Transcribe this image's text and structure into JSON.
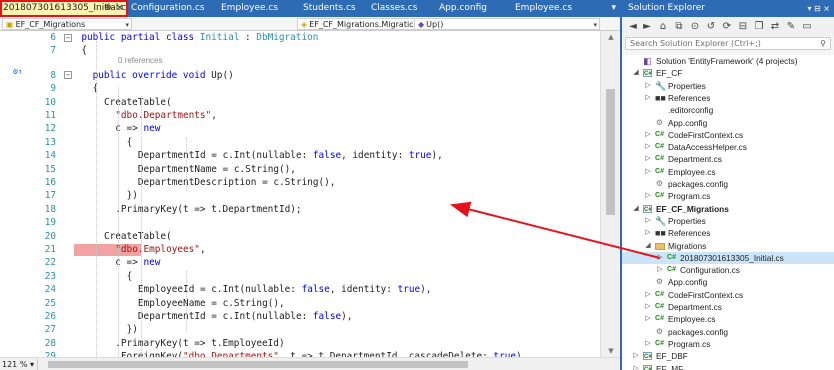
{
  "editor": {
    "tabs": [
      {
        "label": "201807301613305_Initial.cs",
        "active": true
      },
      {
        "label": "Configuration.cs",
        "active": false
      },
      {
        "label": "Employee.cs",
        "active": false
      },
      {
        "label": "Students.cs",
        "active": false
      },
      {
        "label": "Classes.cs",
        "active": false
      },
      {
        "label": "App.config",
        "active": false
      },
      {
        "label": "Employee.cs",
        "active": false
      }
    ],
    "pin_glyph": "⊕",
    "close_glyph": "×",
    "overflow_glyph": "▾",
    "nav": {
      "project": "EF_CF_Migrations",
      "class": "EF_CF_Migrations.Migratic",
      "member": "Up()"
    },
    "codelens": "0 references",
    "zoom": "121 %",
    "lines": [
      {
        "num": "6",
        "indent": 2,
        "tokens": [
          {
            "t": "public partial class ",
            "c": "kw"
          },
          {
            "t": "Initial",
            "c": "cls"
          },
          {
            "t": " : ",
            "c": ""
          },
          {
            "t": "DbMigration",
            "c": "cls"
          }
        ]
      },
      {
        "num": "7",
        "indent": 2,
        "tokens": [
          {
            "t": "{",
            "c": ""
          }
        ]
      },
      {
        "num": "8",
        "indent": 4,
        "tokens": [
          {
            "t": "public override void ",
            "c": "kw"
          },
          {
            "t": "Up()",
            "c": ""
          }
        ]
      },
      {
        "num": "9",
        "indent": 4,
        "tokens": [
          {
            "t": "{",
            "c": ""
          }
        ]
      },
      {
        "num": "10",
        "indent": 6,
        "tokens": [
          {
            "t": "CreateTable(",
            "c": ""
          }
        ]
      },
      {
        "num": "11",
        "indent": 8,
        "tokens": [
          {
            "t": "\"dbo.Departments\"",
            "c": "str"
          },
          {
            "t": ",",
            "c": ""
          }
        ]
      },
      {
        "num": "12",
        "indent": 8,
        "tokens": [
          {
            "t": "c => ",
            "c": ""
          },
          {
            "t": "new",
            "c": "kw"
          }
        ]
      },
      {
        "num": "13",
        "indent": 10,
        "tokens": [
          {
            "t": "{",
            "c": ""
          }
        ]
      },
      {
        "num": "14",
        "indent": 12,
        "tokens": [
          {
            "t": "DepartmentId = c.Int(nullable: ",
            "c": ""
          },
          {
            "t": "false",
            "c": "kw"
          },
          {
            "t": ", identity: ",
            "c": ""
          },
          {
            "t": "true",
            "c": "kw"
          },
          {
            "t": "),",
            "c": ""
          }
        ]
      },
      {
        "num": "15",
        "indent": 12,
        "tokens": [
          {
            "t": "DepartmentName = c.String(),",
            "c": ""
          }
        ]
      },
      {
        "num": "16",
        "indent": 12,
        "tokens": [
          {
            "t": "DepartmentDescription = c.String(),",
            "c": ""
          }
        ]
      },
      {
        "num": "17",
        "indent": 10,
        "tokens": [
          {
            "t": "})",
            "c": ""
          }
        ]
      },
      {
        "num": "18",
        "indent": 8,
        "tokens": [
          {
            "t": ".PrimaryKey(t => t.DepartmentId);",
            "c": ""
          }
        ]
      },
      {
        "num": "19",
        "indent": 0,
        "tokens": []
      },
      {
        "num": "20",
        "indent": 6,
        "tokens": [
          {
            "t": "CreateTable(",
            "c": ""
          }
        ]
      },
      {
        "num": "21",
        "indent": 8,
        "tokens": [
          {
            "t": "\"dbo.Employees\"",
            "c": "str"
          },
          {
            "t": ",",
            "c": ""
          }
        ]
      },
      {
        "num": "22",
        "indent": 8,
        "tokens": [
          {
            "t": "c => ",
            "c": ""
          },
          {
            "t": "new",
            "c": "kw"
          }
        ]
      },
      {
        "num": "23",
        "indent": 10,
        "tokens": [
          {
            "t": "{",
            "c": ""
          }
        ]
      },
      {
        "num": "24",
        "indent": 12,
        "tokens": [
          {
            "t": "EmployeeId = c.Int(nullable: ",
            "c": ""
          },
          {
            "t": "false",
            "c": "kw"
          },
          {
            "t": ", identity: ",
            "c": ""
          },
          {
            "t": "true",
            "c": "kw"
          },
          {
            "t": "),",
            "c": ""
          }
        ]
      },
      {
        "num": "25",
        "indent": 12,
        "tokens": [
          {
            "t": "EmployeeName = c.String(),",
            "c": ""
          }
        ]
      },
      {
        "num": "26",
        "indent": 12,
        "tokens": [
          {
            "t": "DepartmentId = c.Int(nullable: ",
            "c": ""
          },
          {
            "t": "false",
            "c": "kw"
          },
          {
            "t": "),",
            "c": ""
          }
        ]
      },
      {
        "num": "27",
        "indent": 10,
        "tokens": [
          {
            "t": "})",
            "c": ""
          }
        ]
      },
      {
        "num": "28",
        "indent": 8,
        "tokens": [
          {
            "t": ".PrimaryKey(t => t.EmployeeId)",
            "c": ""
          }
        ]
      },
      {
        "num": "29",
        "indent": 8,
        "tokens": [
          {
            "t": ".ForeignKey(",
            "c": ""
          },
          {
            "t": "\"dbo.Departments\"",
            "c": "str"
          },
          {
            "t": ", t => t.DepartmentId, cascadeDelete: ",
            "c": ""
          },
          {
            "t": "true",
            "c": "kw"
          },
          {
            "t": ")",
            "c": ""
          }
        ]
      }
    ]
  },
  "solution_explorer": {
    "title": "Solution Explorer",
    "title_icons": "▾ ⊟ ×",
    "search_placeholder": "Search Solution Explorer (Ctrl+;)",
    "tree": [
      {
        "label": "Solution 'EntityFramework' (4 projects)",
        "level": 0,
        "icon": "solution",
        "expander": "",
        "bold": false,
        "selected": false
      },
      {
        "label": "EF_CF",
        "level": 0,
        "icon": "csproj",
        "expander": "◢",
        "bold": false,
        "selected": false
      },
      {
        "label": "Properties",
        "level": 1,
        "icon": "props",
        "expander": "▷",
        "bold": false,
        "selected": false
      },
      {
        "label": "References",
        "level": 1,
        "icon": "refs",
        "expander": "▷",
        "bold": false,
        "selected": false
      },
      {
        "label": ".editorconfig",
        "level": 1,
        "icon": "none",
        "expander": "",
        "bold": false,
        "selected": false
      },
      {
        "label": "App.config",
        "level": 1,
        "icon": "config",
        "expander": "",
        "bold": false,
        "selected": false
      },
      {
        "label": "CodeFirstContext.cs",
        "level": 1,
        "icon": "cs",
        "expander": "▷",
        "bold": false,
        "selected": false
      },
      {
        "label": "DataAccessHelper.cs",
        "level": 1,
        "icon": "cs",
        "expander": "▷",
        "bold": false,
        "selected": false
      },
      {
        "label": "Department.cs",
        "level": 1,
        "icon": "cs",
        "expander": "▷",
        "bold": false,
        "selected": false
      },
      {
        "label": "Employee.cs",
        "level": 1,
        "icon": "cs",
        "expander": "▷",
        "bold": false,
        "selected": false
      },
      {
        "label": "packages.config",
        "level": 1,
        "icon": "config",
        "expander": "",
        "bold": false,
        "selected": false
      },
      {
        "label": "Program.cs",
        "level": 1,
        "icon": "cs",
        "expander": "▷",
        "bold": false,
        "selected": false
      },
      {
        "label": "EF_CF_Migrations",
        "level": 0,
        "icon": "csproj",
        "expander": "◢",
        "bold": true,
        "selected": false
      },
      {
        "label": "Properties",
        "level": 1,
        "icon": "props",
        "expander": "▷",
        "bold": false,
        "selected": false
      },
      {
        "label": "References",
        "level": 1,
        "icon": "refs",
        "expander": "▷",
        "bold": false,
        "selected": false
      },
      {
        "label": "Migrations",
        "level": 1,
        "icon": "folder",
        "expander": "◢",
        "bold": false,
        "selected": false
      },
      {
        "label": "201807301613305_Initial.cs",
        "level": 2,
        "icon": "cs",
        "expander": "▷",
        "bold": false,
        "selected": true
      },
      {
        "label": "Configuration.cs",
        "level": 2,
        "icon": "cs",
        "expander": "▷",
        "bold": false,
        "selected": false
      },
      {
        "label": "App.config",
        "level": 1,
        "icon": "config",
        "expander": "",
        "bold": false,
        "selected": false
      },
      {
        "label": "CodeFirstContext.cs",
        "level": 1,
        "icon": "cs",
        "expander": "▷",
        "bold": false,
        "selected": false
      },
      {
        "label": "Department.cs",
        "level": 1,
        "icon": "cs",
        "expander": "▷",
        "bold": false,
        "selected": false
      },
      {
        "label": "Employee.cs",
        "level": 1,
        "icon": "cs",
        "expander": "▷",
        "bold": false,
        "selected": false
      },
      {
        "label": "packages.config",
        "level": 1,
        "icon": "config",
        "expander": "",
        "bold": false,
        "selected": false
      },
      {
        "label": "Program.cs",
        "level": 1,
        "icon": "cs",
        "expander": "▷",
        "bold": false,
        "selected": false
      },
      {
        "label": "EF_DBF",
        "level": 0,
        "icon": "csproj",
        "expander": "▷",
        "bold": false,
        "selected": false
      },
      {
        "label": "EF_MF",
        "level": 0,
        "icon": "csproj",
        "expander": "▷",
        "bold": false,
        "selected": false
      }
    ]
  },
  "annotation": {
    "arrow_color": "#e8101a",
    "highlight_color": "#f3a1a1"
  }
}
